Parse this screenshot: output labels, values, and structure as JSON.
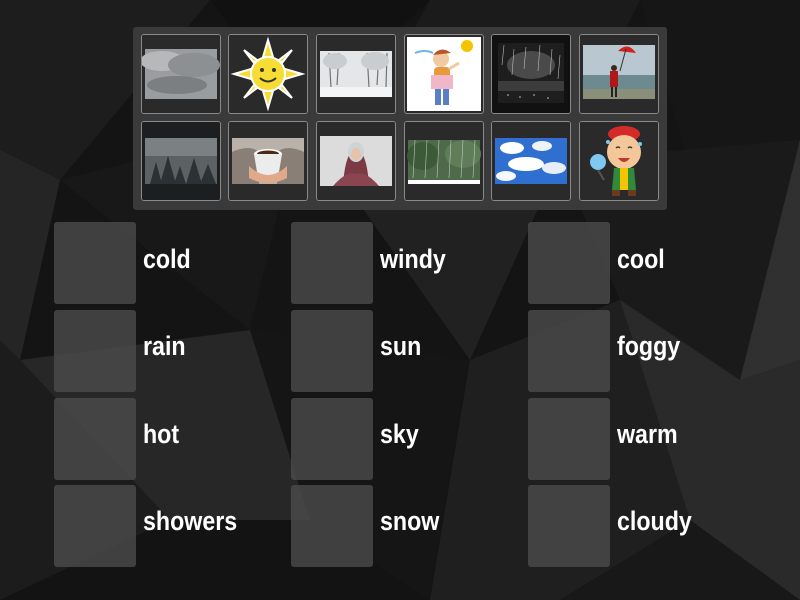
{
  "palette": {
    "background": "#141414",
    "tray": "#3a3a3a",
    "slot": "#4a4a4a",
    "tile_border": "#8a8a8a",
    "text": "#ffffff"
  },
  "image_tiles": [
    {
      "picture": "overcast-clouds"
    },
    {
      "picture": "smiling-sun-cartoon"
    },
    {
      "picture": "snowy-trees"
    },
    {
      "picture": "windy-cartoon-person"
    },
    {
      "picture": "rain-through-window"
    },
    {
      "picture": "person-with-umbrella-in-wind"
    },
    {
      "picture": "foggy-forest"
    },
    {
      "picture": "hands-holding-warm-drink"
    },
    {
      "picture": "person-cold-in-blanket"
    },
    {
      "picture": "rain-shower-over-trees"
    },
    {
      "picture": "blue-sky-with-clouds"
    },
    {
      "picture": "hot-sweating-cartoon-with-fan"
    }
  ],
  "answer_slots": [
    {
      "word": "cold"
    },
    {
      "word": "windy"
    },
    {
      "word": "cool"
    },
    {
      "word": "rain"
    },
    {
      "word": "sun"
    },
    {
      "word": "foggy"
    },
    {
      "word": "hot"
    },
    {
      "word": "sky"
    },
    {
      "word": "warm"
    },
    {
      "word": "showers"
    },
    {
      "word": "snow"
    },
    {
      "word": "cloudy"
    }
  ]
}
